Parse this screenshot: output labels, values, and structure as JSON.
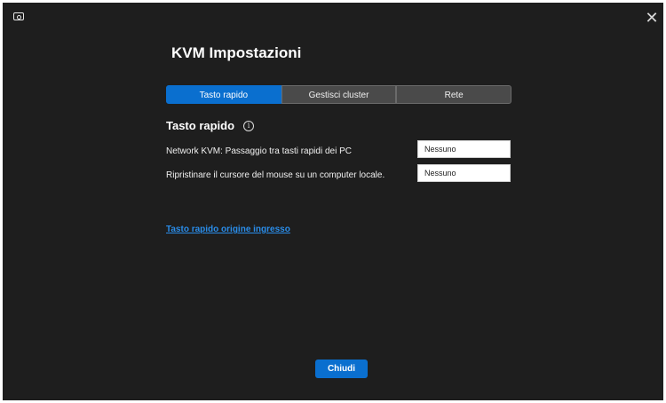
{
  "window": {
    "app_icon": "monitor-icon",
    "close_icon": "close-icon",
    "close_glyph": "✕"
  },
  "title": "KVM Impostazioni",
  "tabs": [
    {
      "label": "Tasto rapido",
      "active": true
    },
    {
      "label": "Gestisci cluster",
      "active": false
    },
    {
      "label": "Rete",
      "active": false
    }
  ],
  "section": {
    "title": "Tasto rapido",
    "info_glyph": "i"
  },
  "rows": [
    {
      "label": "Network KVM: Passaggio tra tasti rapidi dei PC",
      "value": "Nessuno"
    },
    {
      "label": "Ripristinare il cursore del mouse su un computer locale.",
      "value": "Nessuno"
    }
  ],
  "link": "Tasto rapido origine ingresso",
  "footer": {
    "close_label": "Chiudi"
  },
  "colors": {
    "background": "#1e1e1e",
    "accent": "#0a6fcf",
    "link": "#2a8dea",
    "tab_inactive": "#4a4a4a"
  }
}
